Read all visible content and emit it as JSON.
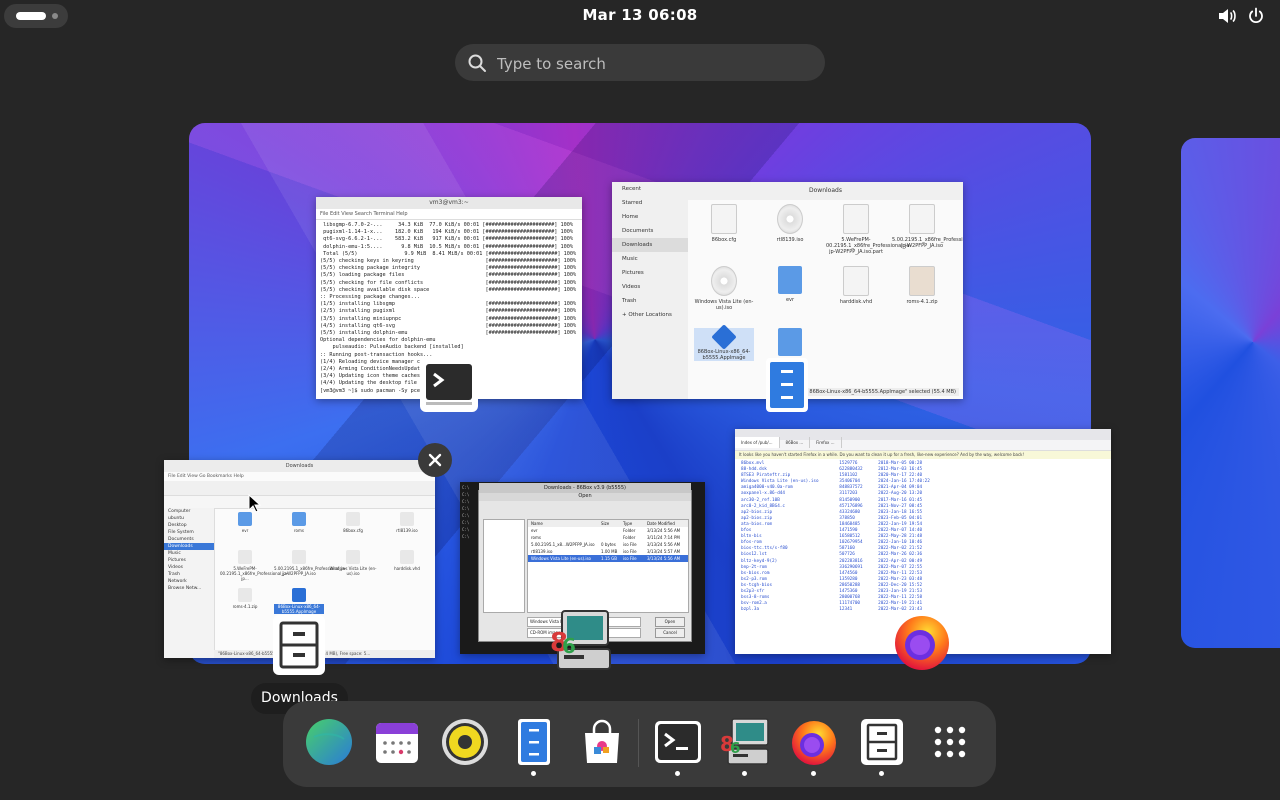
{
  "topbar": {
    "clock": "Mar 13  06:08",
    "activities": "activities",
    "volume_icon": "volume-icon",
    "power_icon": "power-icon"
  },
  "search": {
    "placeholder": "Type to search"
  },
  "terminal_window": {
    "title": "vm3@vm3:~",
    "menu": "File   Edit   View   Search   Terminal   Help",
    "lines": [
      " libsgmp-6.7.0-2-...     34.3 KiB  77.0 KiB/s 00:01 [######################] 100%",
      " pugixml-1.14-1-x...    182.0 KiB   194 KiB/s 00:01 [######################] 100%",
      " qt6-svg-6.6.2-1-...    583.2 KiB   917 KiB/s 00:01 [######################] 100%",
      " dolphin-emu-1:5....      9.8 MiB  10.5 MiB/s 00:01 [######################] 100%",
      " Total (5/5)               9.9 MiB  8.41 MiB/s 00:01 [######################] 100%",
      "(5/5) checking keys in keyring                       [######################] 100%",
      "(5/5) checking package integrity                     [######################] 100%",
      "(5/5) loading package files                          [######################] 100%",
      "(5/5) checking for file conflicts                    [######################] 100%",
      "(5/5) checking available disk space                  [######################] 100%",
      ":: Processing package changes...",
      "(1/5) installing libsgmp                             [######################] 100%",
      "(2/5) installing pugixml                             [######################] 100%",
      "(3/5) installing miniupnpc                           [######################] 100%",
      "(4/5) installing qt6-svg                             [######################] 100%",
      "(5/5) installing dolphin-emu                         [######################] 100%",
      "Optional dependencies for dolphin-emu",
      "    pulseaudio: PulseAudio backend [installed]",
      ":: Running post-transaction hooks...",
      "(1/4) Reloading device manager configuration...",
      "(2/4) Arming ConditionNeedsUpdate...",
      "(3/4) Updating icon theme caches...",
      "(4/4) Updating the desktop file MIME type cache...",
      "[vm3@vm3 ~]$ sudo pacman -Sy pcem xemu pcsx2"
    ]
  },
  "files_window": {
    "sidebar": [
      "Recent",
      "Starred",
      "Home",
      "Documents",
      "Downloads",
      "Music",
      "Pictures",
      "Videos",
      "Trash",
      "+ Other Locations"
    ],
    "path": "Downloads",
    "items": [
      {
        "name": "86box.cfg",
        "type": "doc"
      },
      {
        "name": "rtl8139.iso",
        "type": "disc"
      },
      {
        "name": "5.00.2195.1_x86fre_Professional_ja-jp-W2PFPP_JA.iso.part",
        "label": "5.WeFrePM-00.2195.1_x86fre_Professional_ja-jp-W2PFPP_JA.iso.part",
        "type": "doc"
      },
      {
        "name": "5.00.2195.1_x86fre_Professional_ja-jp-W2PFPP_JA.iso",
        "label": "5.00.2195.1_x86fre_Professional_ja-jp-W2PFPP_JA.iso",
        "type": "doc"
      },
      {
        "name": "Windows Vista Lite (en-us).iso",
        "type": "disc"
      },
      {
        "name": "evr",
        "type": "fold"
      },
      {
        "name": "harddisk.vhd",
        "type": "doc"
      },
      {
        "name": "roms-4.1.zip",
        "type": "zip"
      },
      {
        "name": "86Box-Linux-x86_64-b5555.AppImage",
        "type": "app"
      },
      {
        "name": "",
        "type": "fold"
      }
    ],
    "status": "86Box-Linux-x86_64-b5555.AppImage\" selected (55.4 MB)"
  },
  "fm2_window": {
    "title": "Downloads",
    "menu": "File   Edit   View   Go   Bookmarks   Help",
    "sidebar": [
      "Computer",
      "ubuntu",
      "Desktop",
      "File System",
      "Documents",
      "Downloads",
      "Music",
      "Pictures",
      "Videos",
      "Trash",
      "Network",
      "Browse Netw..."
    ],
    "items": [
      "evr",
      "roms",
      "86box.cfg",
      "rtl8139.iso",
      "5.WeFrePM-00.2195.1_x86fre_Professional_ja-jp...",
      "5.00.2195.1_x86fre_Professional_ja-jp-W2PFPP_JA.iso",
      "Windows Vista Lite (en-us).iso",
      "harddisk.vhd",
      "roms-4.1.zip",
      "86Box-Linux-x86_64-b5555.AppImage"
    ],
    "status": "\"86Box-Linux-x86_64-b5555.AppImage\" selected (55.4 MB), Free space: 5..."
  },
  "dialog_window": {
    "title": "Downloads - 86Box v3.9 (b5555)",
    "dialog_title": "Open",
    "columns": [
      "Name",
      "Size",
      "Type",
      "Date Modified"
    ],
    "rows": [
      [
        "evr",
        "",
        "Folder",
        "3/13/24 5:56 AM"
      ],
      [
        "roms",
        "",
        "Folder",
        "3/11/24 7:14 PM"
      ],
      [
        "5.00.2195.1_x8...W2PFPP_JA.iso",
        "0 bytes",
        "iso File",
        "3/13/24 5:56 AM"
      ],
      [
        "rtl8139.iso",
        "1.00 MB",
        "iso File",
        "3/13/24 5:57 AM"
      ],
      [
        "Windows Vista Lite (en-us).iso",
        "1.15 GB",
        "iso File",
        "3/13/24 5:56 AM"
      ]
    ],
    "file_name": "Windows Vista Lite (e...",
    "file_type": "CD-ROM images (*.iso...",
    "open": "Open",
    "cancel": "Cancel"
  },
  "firefox_window": {
    "tabs": [
      "Index of /pub/...",
      "86Box ...",
      "Firefox ..."
    ],
    "note": "It looks like you haven't started Firefox in a while. Do you want to clean it up for a fresh, like-new experience? And by the way, welcome back!",
    "rows": [
      "86box.mvl                             1529776        2018-Mar-05 00:28",
      "88-hdd.dsk                            622880432      2012-Mar-03 16:45",
      "8TSE3 Pirateftr.zip                   1581102        2020-Mar-17 22:40",
      "Windows Vista Lite (en-us).iso        35406704       2024-Jan-16 17:40:22",
      "amiga4000-v40.0a-rom                  848837572      2021-Apr-04 09:04",
      "aoxpanel-x.86-d44                     3117203        2022-Aug-20 13:20",
      "arc30-2_ref.10B                       81450900       2017-Mar-16 01:45",
      "arc0-2_kid_8BG4.c                     457176896      2021-Nov-27 08:45",
      "ap2-bios.zip                          43324680       2023-Jan-18 16:55",
      "ap2-bios.zip                          378850         2023-Feb-05 04:01",
      "ata-bios.rom                          18468485       2022-Jan-19 19:54",
      "bfos                                  1471590        2022-Mar-07 14:40",
      "bltn-bis                              16580512       2022-May-28 21:48",
      "bfos-rom                              102679954      2022-Jan-10 10:46",
      "bios-ttc.tts/s-f80                    587160         2022-Mar-02 21:52",
      "bios12.lst                            507726         2022-Mar-26 02:36",
      "bltz-keyd-9(2)                        202283816      2022-Apr-02 00:49",
      "bnp-2t-rom                            336290691      2022-Mar-07 22:55",
      "bs-bios.rom                           1474560        2022-Mar-11 22:53",
      "bs2-p3.rom                            1359280        2022-Mar-23 03:48",
      "bs-tcgh-bios                          28650288       2022-Dec-20 15:52",
      "bs2p3-sfr                             1475360        2023-Jan-19 21:53",
      "bss3-8-roms                           28000768       2022-Mar-11 22:58",
      "bsv-rom2.a                            11174700       2022-Mar-19 21:41",
      "bzpl.3a                               12341          2022-Mar-02 23:43"
    ]
  },
  "close_icon": "close-icon",
  "tooltip": "Downloads",
  "dock": {
    "items": [
      {
        "name": "web-browser-globe",
        "running": false
      },
      {
        "name": "calendar",
        "running": false
      },
      {
        "name": "rhythmbox-music",
        "running": false
      },
      {
        "name": "files",
        "running": true
      },
      {
        "name": "software-store",
        "running": false
      },
      {
        "name": "terminal",
        "running": true
      },
      {
        "name": "86box-emulator",
        "running": true
      },
      {
        "name": "firefox",
        "running": true
      },
      {
        "name": "file-cabinet",
        "running": true
      },
      {
        "name": "show-applications-grid",
        "running": false
      }
    ]
  }
}
